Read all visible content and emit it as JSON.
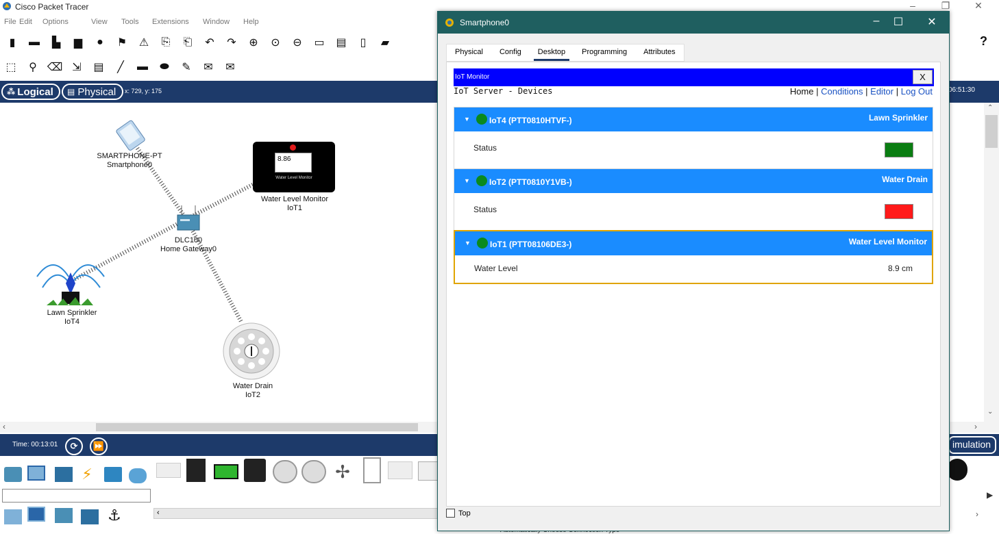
{
  "app": {
    "title": "Cisco Packet Tracer",
    "help_label": "?"
  },
  "menu": [
    "File",
    "Edit",
    "Options",
    "View",
    "Tools",
    "Extensions",
    "Window",
    "Help"
  ],
  "workspace": {
    "logical_label": "Logical",
    "physical_label": "Physical",
    "coordinates": "x: 729, y: 175",
    "clock": "06:51:30"
  },
  "devices": {
    "smartphone": {
      "model": "SMARTPHONE-PT",
      "name": "Smartphone0"
    },
    "water_monitor": {
      "reading": "8.86",
      "panel_label": "Water Level Monitor",
      "model": "Water Level Monitor",
      "name": "IoT1"
    },
    "gateway": {
      "model": "DLC100",
      "name": "Home Gateway0"
    },
    "sprinkler": {
      "model": "Lawn Sprinkler",
      "name": "IoT4"
    },
    "drain": {
      "model": "Water Drain",
      "name": "IoT2"
    }
  },
  "timebar": {
    "time": "Time: 00:13:01",
    "simulation_label": "imulation"
  },
  "palette": {
    "caption": "Automatically Choose Connection Type"
  },
  "phone_window": {
    "title": "Smartphone0",
    "tabs": [
      "Physical",
      "Config",
      "Desktop",
      "Programming",
      "Attributes"
    ],
    "active_tab": "Desktop",
    "top_checkbox_label": "Top",
    "iot": {
      "header": "IoT Monitor",
      "close_label": "X",
      "server_title": "IoT Server - Devices",
      "nav": {
        "home": "Home",
        "sep1": " | ",
        "conditions": "Conditions",
        "sep2": " | ",
        "editor": "Editor",
        "sep3": " | ",
        "logout": "Log Out"
      },
      "devices": [
        {
          "name": "IoT4 (PTT0810HTVF-)",
          "type": "Lawn Sprinkler",
          "field": "Status",
          "value": "",
          "status_color": "#0a7d12"
        },
        {
          "name": "IoT2 (PTT0810Y1VB-)",
          "type": "Water Drain",
          "field": "Status",
          "value": "",
          "status_color": "#ff1a1a"
        },
        {
          "name": "IoT1 (PTT08106DE3-)",
          "type": "Water Level Monitor",
          "field": "Water Level",
          "value": "8.9 cm",
          "status_color": ""
        }
      ]
    }
  },
  "colors": {
    "dark_bar": "#1d3a6a",
    "window_title": "#1f5f60",
    "iot_header": "#0000ff",
    "device_header": "#1a8cff",
    "status_on": "#0a7d12",
    "status_off": "#ff1a1a"
  }
}
